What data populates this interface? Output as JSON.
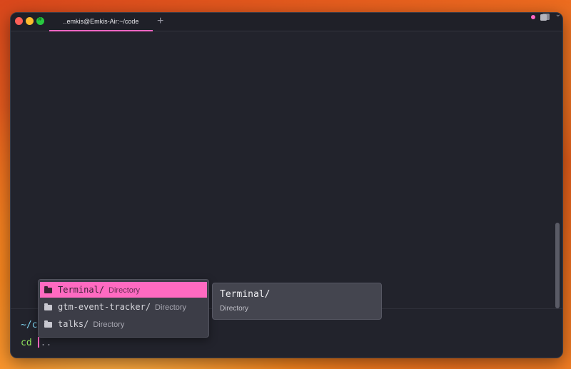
{
  "window": {
    "tab_title": "..emkis@Emkis-Air:~/code",
    "new_tab_label": "+"
  },
  "prompt": {
    "path": "~/c",
    "command": "cd",
    "argument": ".."
  },
  "completions": [
    {
      "name": "Terminal/",
      "type": "Directory",
      "selected": true
    },
    {
      "name": "gtm-event-tracker/",
      "type": "Directory",
      "selected": false
    },
    {
      "name": "talks/",
      "type": "Directory",
      "selected": false
    }
  ],
  "preview": {
    "title": "Terminal/",
    "description": "Directory"
  },
  "colors": {
    "accent": "#ff66c4",
    "background": "#22232c",
    "command": "#8fe35a",
    "path": "#7fd6f2"
  },
  "icons": [
    "close-icon",
    "minimize-icon",
    "fullscreen-icon",
    "plus-icon",
    "panes-icon",
    "chevron-down-icon",
    "folder-icon"
  ]
}
